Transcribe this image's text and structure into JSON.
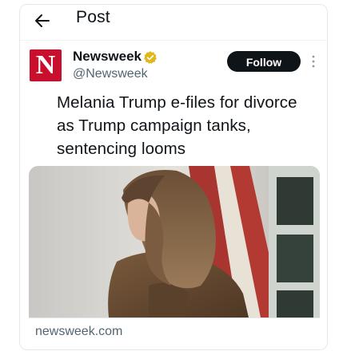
{
  "header": {
    "title": "Post",
    "back_icon": "arrow-left-icon"
  },
  "author": {
    "name": "Newsweek",
    "handle": "@Newsweek",
    "logo_letter": "N",
    "logo_color": "#c8102e",
    "verified_icon": "verified-gold-badge-icon",
    "verified_color": "#e2b719"
  },
  "actions": {
    "follow_label": "Follow",
    "more_icon": "more-vertical-icon"
  },
  "tweet": {
    "lines": [
      "Melania Trump e-files for divorce",
      "as Trump campaign tanks,",
      "sentencing looms"
    ]
  },
  "link_card": {
    "domain": "newsweek.com"
  }
}
